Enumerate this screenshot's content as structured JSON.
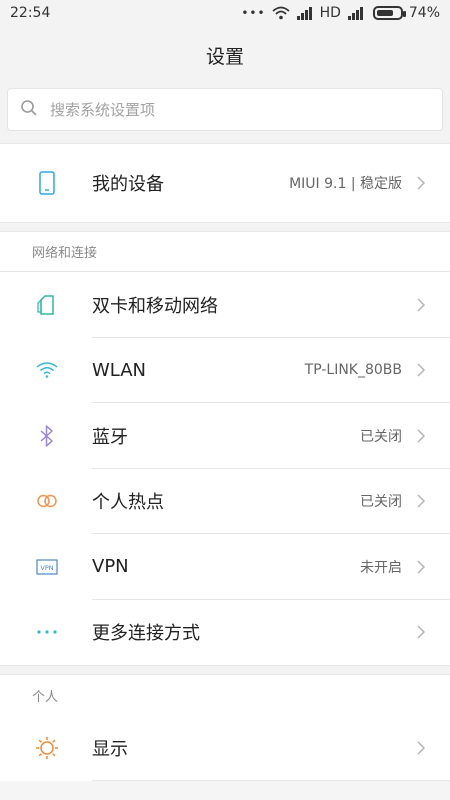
{
  "status": {
    "time": "22:54",
    "dots": "•••",
    "network": "HD",
    "battery": "74%",
    "battery_level": 0.74
  },
  "header": {
    "title": "设置"
  },
  "search": {
    "placeholder": "搜索系统设置项"
  },
  "device": {
    "label": "我的设备",
    "value": "MIUI 9.1 | 稳定版"
  },
  "sections": [
    {
      "title": "网络和连接",
      "items": [
        {
          "label": "双卡和移动网络",
          "value": "",
          "icon": "sim-card-icon"
        },
        {
          "label": "WLAN",
          "value": "TP-LINK_80BB",
          "icon": "wifi-icon"
        },
        {
          "label": "蓝牙",
          "value": "已关闭",
          "icon": "bluetooth-icon"
        },
        {
          "label": "个人热点",
          "value": "已关闭",
          "icon": "hotspot-icon"
        },
        {
          "label": "VPN",
          "value": "未开启",
          "icon": "vpn-icon"
        },
        {
          "label": "更多连接方式",
          "value": "",
          "icon": "more-dots-icon"
        }
      ]
    },
    {
      "title": "个人",
      "items": [
        {
          "label": "显示",
          "value": "",
          "icon": "sun-icon"
        }
      ]
    }
  ],
  "colors": {
    "sim": "#2fb8a8",
    "wifi": "#32b8d6",
    "bluetooth": "#9a86d6",
    "hotspot": "#f09550",
    "vpn": "#4a88c8",
    "more": "#2fb8d6",
    "display": "#f08a30",
    "device": "#2ea8e0"
  },
  "vpn_icon_text": "VPN"
}
